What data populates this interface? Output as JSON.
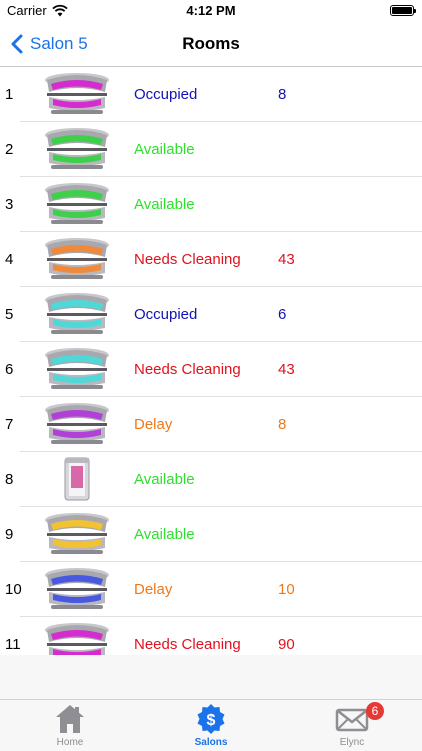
{
  "status_bar": {
    "carrier": "Carrier",
    "time": "4:12 PM"
  },
  "nav": {
    "back_label": "Salon 5",
    "title": "Rooms"
  },
  "colors": {
    "occupied": "#1212b8",
    "available": "#2ee02e",
    "needs_cleaning": "#e0121e",
    "delay": "#f07818",
    "accent": "#1a73e8"
  },
  "rooms": [
    {
      "num": "1",
      "status": "Occupied",
      "mins": "8",
      "status_key": "occupied",
      "bed": "magenta"
    },
    {
      "num": "2",
      "status": "Available",
      "mins": "",
      "status_key": "available",
      "bed": "green"
    },
    {
      "num": "3",
      "status": "Available",
      "mins": "",
      "status_key": "available",
      "bed": "green"
    },
    {
      "num": "4",
      "status": "Needs Cleaning",
      "mins": "43",
      "status_key": "needs_cleaning",
      "bed": "orange"
    },
    {
      "num": "5",
      "status": "Occupied",
      "mins": "6",
      "status_key": "occupied",
      "bed": "cyan"
    },
    {
      "num": "6",
      "status": "Needs Cleaning",
      "mins": "43",
      "status_key": "needs_cleaning",
      "bed": "cyan"
    },
    {
      "num": "7",
      "status": "Delay",
      "mins": "8",
      "status_key": "delay",
      "bed": "purple"
    },
    {
      "num": "8",
      "status": "Available",
      "mins": "",
      "status_key": "available",
      "bed": "booth"
    },
    {
      "num": "9",
      "status": "Available",
      "mins": "",
      "status_key": "available",
      "bed": "yellow"
    },
    {
      "num": "10",
      "status": "Delay",
      "mins": "10",
      "status_key": "delay",
      "bed": "blue"
    },
    {
      "num": "11",
      "status": "Needs Cleaning",
      "mins": "90",
      "status_key": "needs_cleaning",
      "bed": "magenta"
    }
  ],
  "tabs": {
    "home": {
      "label": "Home",
      "icon": "house-icon"
    },
    "salons": {
      "label": "Salons",
      "icon": "dollar-badge-icon"
    },
    "elync": {
      "label": "Elync",
      "icon": "envelope-icon",
      "badge": "6"
    }
  }
}
